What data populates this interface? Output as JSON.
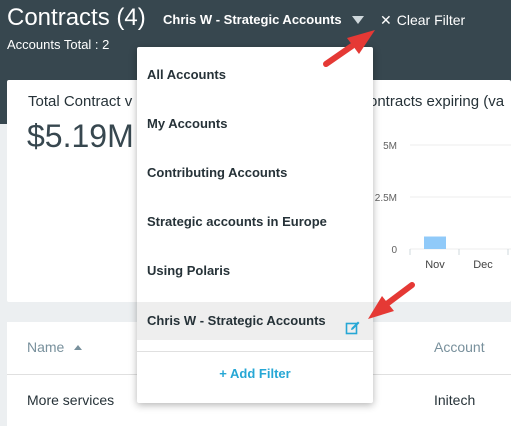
{
  "header": {
    "title": "Contracts (4)",
    "subtitle": "Accounts Total : 2",
    "selected_filter": "Chris W - Strategic Accounts",
    "clear_filter_label": "Clear Filter"
  },
  "summary": {
    "total_label": "Total Contract v",
    "total_value": "$5.19M",
    "expiring_label": "ontracts expiring (va"
  },
  "chart_data": {
    "type": "bar",
    "categories": [
      "Nov",
      "Dec"
    ],
    "values": [
      0.6,
      0
    ],
    "yticks": [
      "5M",
      "2.5M",
      "0"
    ],
    "ylim": [
      0,
      5
    ],
    "bar_color": "#90caf9"
  },
  "table": {
    "columns": [
      "Name",
      "Account"
    ],
    "rows": [
      {
        "name": "More services",
        "account": "Initech"
      }
    ]
  },
  "dropdown": {
    "items": [
      "All Accounts",
      "My Accounts",
      "Contributing Accounts",
      "Strategic accounts in Europe",
      "Using Polaris",
      "Chris W - Strategic Accounts"
    ],
    "add_filter_label": "+ Add Filter"
  },
  "colors": {
    "header_bg": "#37474f",
    "accent": "#26a7d5",
    "arrow": "#e53935"
  }
}
